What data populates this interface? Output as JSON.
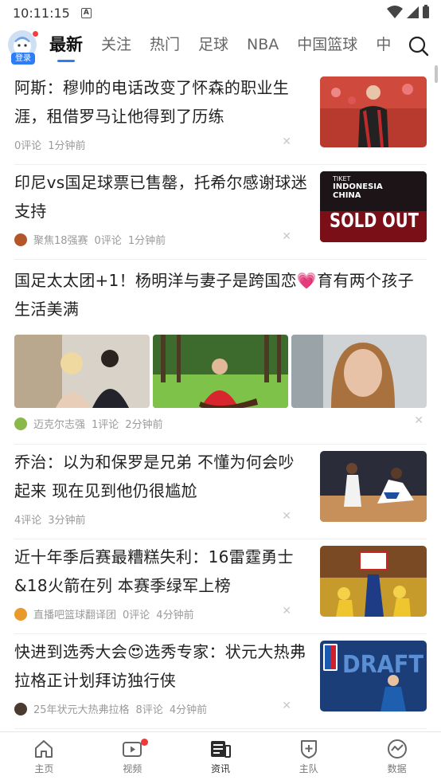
{
  "status_bar": {
    "time": "10:11:15",
    "notif_icon": "A"
  },
  "header": {
    "login_badge": "登录",
    "tabs": [
      {
        "label": "最新",
        "active": true
      },
      {
        "label": "关注"
      },
      {
        "label": "热门"
      },
      {
        "label": "足球"
      },
      {
        "label": "NBA"
      },
      {
        "label": "中国篮球"
      },
      {
        "label": "中"
      }
    ]
  },
  "feed": [
    {
      "title": "阿斯：穆帅的电话改变了怀森的职业生涯，租借罗马让他得到了历练",
      "source": "",
      "comments": "0评论",
      "time": "1分钟前",
      "thumb": "soccer-player-red-jersey"
    },
    {
      "title": "印尼vs国足球票已售罄，托希尔感谢球迷支持",
      "source": "聚焦18强赛",
      "comments": "0评论",
      "time": "1分钟前",
      "thumb": "sold-out-poster",
      "thumb_text": {
        "line1": "TIKET",
        "line2": "INDONESIA",
        "line3": "CHINA",
        "line4": "SOLD OUT"
      }
    },
    {
      "title": "国足太太团+1！杨明洋与妻子是跨国恋",
      "title_emoji": "💗",
      "title_rest": "育有两个孩子生活美满",
      "source": "迈克尔志强",
      "comments": "1评论",
      "time": "2分钟前",
      "thumbs": [
        "couple-photo",
        "forest-boat-photo",
        "selfie-photo"
      ]
    },
    {
      "title": "乔治：以为和保罗是兄弟 不懂为何会吵起来 现在见到他仍很尴尬",
      "source": "",
      "comments": "4评论",
      "time": "3分钟前",
      "thumb": "basketball-court"
    },
    {
      "title": "近十年季后赛最糟糕失利：16雷霆勇士&18火箭在列 本赛季绿军上榜",
      "source": "直播吧篮球翻译团",
      "comments": "0评论",
      "time": "4分钟前",
      "thumb": "basketball-dunk"
    },
    {
      "title": "快进到选秀大会",
      "title_emoji": "😍",
      "title_rest": "选秀专家：状元大热弗拉格正计划拜访独行侠",
      "source": "25年状元大热弗拉格",
      "comments": "8评论",
      "time": "4分钟前",
      "thumb": "nba-draft",
      "thumb_text": {
        "line1": "DRAFT"
      }
    }
  ],
  "bottom_nav": [
    {
      "label": "主页",
      "icon": "home-icon"
    },
    {
      "label": "视频",
      "icon": "video-icon",
      "dot": true
    },
    {
      "label": "资讯",
      "icon": "news-icon",
      "active": true
    },
    {
      "label": "主队",
      "icon": "team-shield-icon"
    },
    {
      "label": "数据",
      "icon": "data-icon"
    }
  ],
  "colors": {
    "accent": "#2d7df6",
    "badge_red": "#f03838"
  }
}
